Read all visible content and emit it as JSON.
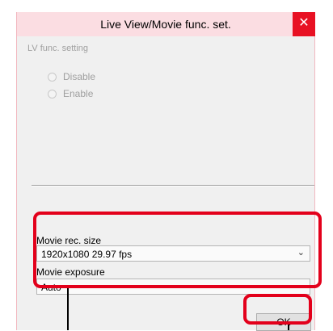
{
  "window": {
    "title": "Live View/Movie func. set.",
    "close_glyph": "✕"
  },
  "lv_group": {
    "label": "LV func. setting",
    "options": [
      "Disable",
      "Enable"
    ]
  },
  "movie": {
    "rec_size_label": "Movie rec. size",
    "rec_size_value": "1920x1080  29.97 fps",
    "exposure_label": "Movie exposure",
    "exposure_value": "Auto"
  },
  "buttons": {
    "ok": "OK"
  },
  "colors": {
    "highlight": "#e3001b",
    "close_button": "#e81123",
    "titlebar": "#fbdde2"
  }
}
